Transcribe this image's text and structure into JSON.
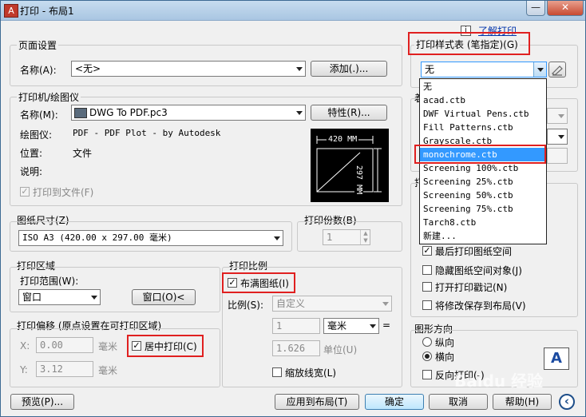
{
  "window": {
    "title": "打印 - 布局1",
    "help_link": "了解打印"
  },
  "titlebar_buttons": {
    "close": "✕",
    "minimize": "—"
  },
  "page_setup": {
    "label": "页面设置",
    "name_label": "名称(A):",
    "name_value": "<无>",
    "add_button": "添加(.)..."
  },
  "printer": {
    "label": "打印机/绘图仪",
    "name_label": "名称(M):",
    "name_value": "DWG To PDF.pc3",
    "properties_button": "特性(R)...",
    "plotter_label": "绘图仪:",
    "plotter_value": "PDF - PDF Plot - by Autodesk",
    "location_label": "位置:",
    "location_value": "文件",
    "description_label": "说明:",
    "print_to_file": "打印到文件(F)",
    "preview_width": "420 MM",
    "preview_height": "297 MM"
  },
  "paper_size": {
    "label": "图纸尺寸(Z)",
    "value": "ISO A3 (420.00 x 297.00 毫米)"
  },
  "copies": {
    "label": "打印份数(B)",
    "value": "1"
  },
  "plot_area": {
    "label": "打印区域",
    "range_label": "打印范围(W):",
    "range_value": "窗口",
    "window_button": "窗口(O)<"
  },
  "plot_offset": {
    "label": "打印偏移 (原点设置在可打印区域)",
    "x_label": "X:",
    "x_value": "0.00",
    "x_unit": "毫米",
    "y_label": "Y:",
    "y_value": "3.12",
    "y_unit": "毫米",
    "center_label": "居中打印(C)"
  },
  "plot_scale": {
    "label": "打印比例",
    "fit_label": "布满图纸(I)",
    "scale_label": "比例(S):",
    "scale_value": "自定义",
    "value1": "1",
    "unit_value": "毫米",
    "equals": "=",
    "value2": "1.626",
    "unit2_label": "单位(U)",
    "lineweights_label": "缩放线宽(L)"
  },
  "plot_style": {
    "label": "打印样式表 (笔指定)(G)",
    "selected": "无",
    "options": [
      "无",
      "acad.ctb",
      "DWF Virtual Pens.ctb",
      "Fill Patterns.ctb",
      "Grayscale.ctb",
      "monochrome.ctb",
      "Screening 100%.ctb",
      "Screening 25%.ctb",
      "Screening 50%.ctb",
      "Screening 75%.ctb",
      "Tarch8.ctb",
      "新建..."
    ],
    "highlighted_index": 5
  },
  "partial_labels": {
    "shaded": "着",
    "options": "打"
  },
  "plot_options": {
    "last_paperspace": "最后打印图纸空间",
    "hide_objects": "隐藏图纸空间对象(J)",
    "plot_stamp": "打开打印戳记(N)",
    "save_changes": "将修改保存到布局(V)"
  },
  "orientation": {
    "label": "图形方向",
    "portrait": "纵向",
    "landscape": "横向",
    "upside_down": "反向打印(-)",
    "icon_letter": "A"
  },
  "footer": {
    "preview": "预览(P)...",
    "apply": "应用到布局(T)",
    "ok": "确定",
    "cancel": "取消",
    "help": "帮助(H)",
    "collapse": "‹"
  },
  "watermark": "Baidu 经验"
}
